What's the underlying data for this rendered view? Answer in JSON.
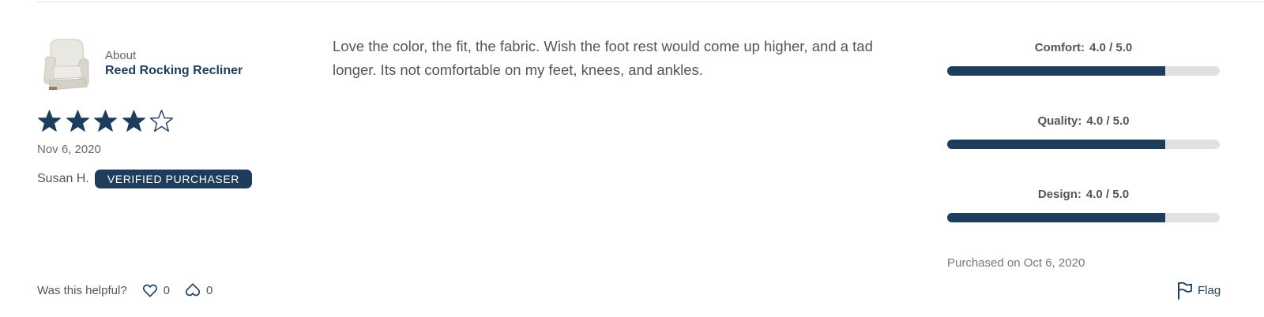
{
  "product": {
    "about_label": "About",
    "name": "Reed Rocking Recliner",
    "thumbnail_icon": "recliner-chair-image"
  },
  "review": {
    "rating": 4,
    "rating_max": 5,
    "date": "Nov 6, 2020",
    "reviewer": "Susan H.",
    "badge": "VERIFIED PURCHASER",
    "body": "Love the color, the fit, the fabric. Wish the foot rest would come up higher, and a tad longer. Its not comfortable on my feet, knees, and ankles."
  },
  "sub_ratings": [
    {
      "label": "Comfort:",
      "value_text": "4.0 / 5.0",
      "value": 4.0,
      "max": 5.0
    },
    {
      "label": "Quality:",
      "value_text": "4.0 / 5.0",
      "value": 4.0,
      "max": 5.0
    },
    {
      "label": "Design:",
      "value_text": "4.0 / 5.0",
      "value": 4.0,
      "max": 5.0
    }
  ],
  "purchased_text": "Purchased on Oct 6, 2020",
  "helpful": {
    "prompt": "Was this helpful?",
    "like_count": "0",
    "dislike_count": "0",
    "like_icon": "heart-outline-icon",
    "dislike_icon": "broken-heart-outline-icon"
  },
  "flag": {
    "label": "Flag",
    "icon": "flag-outline-icon"
  },
  "colors": {
    "accent": "#1e3d5c",
    "bar_track": "#e1e1e1",
    "text": "#555555"
  }
}
